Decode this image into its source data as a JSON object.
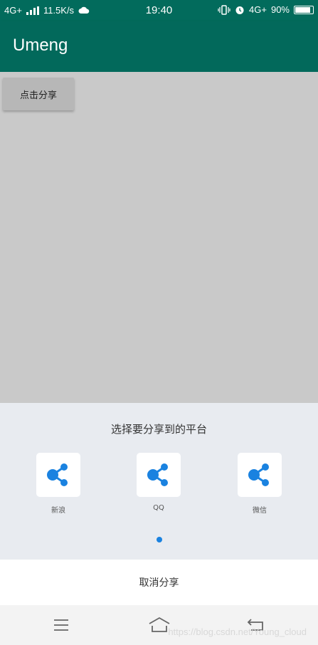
{
  "status_bar": {
    "network_left": "4G+",
    "speed": "11.5K/s",
    "time": "19:40",
    "network_right": "4G+",
    "battery_percent": "90%",
    "battery_level": 0.9
  },
  "app_bar": {
    "title": "Umeng"
  },
  "main": {
    "share_button_label": "点击分享"
  },
  "share_sheet": {
    "title": "选择要分享到的平台",
    "platforms": [
      {
        "label": "新浪",
        "icon": "share-icon"
      },
      {
        "label": "QQ",
        "icon": "share-icon"
      },
      {
        "label": "微信",
        "icon": "share-icon"
      }
    ],
    "page_indicator_active": 1
  },
  "cancel": {
    "label": "取消分享"
  },
  "watermark": "https://blog.csdn.net/Young_cloud",
  "colors": {
    "primary": "#02695b",
    "accent": "#1a82e0",
    "sheet_bg": "#e8ebf0"
  }
}
